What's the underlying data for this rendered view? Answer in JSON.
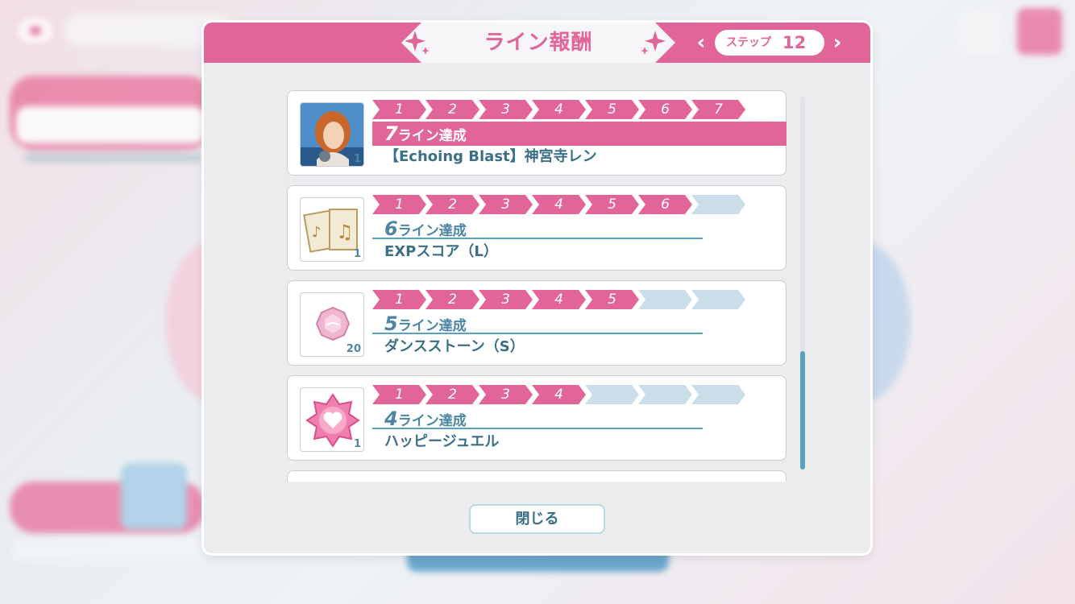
{
  "modal": {
    "title": "ライン報酬",
    "step_label": "ステップ",
    "step_value": "12",
    "close_label": "閉じる"
  },
  "rewards": [
    {
      "lines": "7",
      "achieve_suffix": "ライン達成",
      "name": "【Echoing Blast】神宮寺レン",
      "count": "1",
      "steps": [
        "1",
        "2",
        "3",
        "4",
        "5",
        "6",
        "7"
      ],
      "icon": "idol-card-image"
    },
    {
      "lines": "6",
      "achieve_suffix": "ライン達成",
      "name": "EXPスコア（L）",
      "count": "1",
      "steps": [
        "1",
        "2",
        "3",
        "4",
        "5",
        "6",
        ""
      ],
      "icon": "sheet-music-icon"
    },
    {
      "lines": "5",
      "achieve_suffix": "ライン達成",
      "name": "ダンスストーン（S）",
      "count": "20",
      "steps": [
        "1",
        "2",
        "3",
        "4",
        "5",
        "",
        ""
      ],
      "icon": "dance-stone-icon"
    },
    {
      "lines": "4",
      "achieve_suffix": "ライン達成",
      "name": "ハッピージュエル",
      "count": "1",
      "steps": [
        "1",
        "2",
        "3",
        "4",
        "",
        "",
        ""
      ],
      "icon": "happy-jewel-icon"
    }
  ],
  "colors": {
    "accent": "#e2659a",
    "text_blue": "#3b6f86",
    "inactive_step": "#c9dee8"
  }
}
